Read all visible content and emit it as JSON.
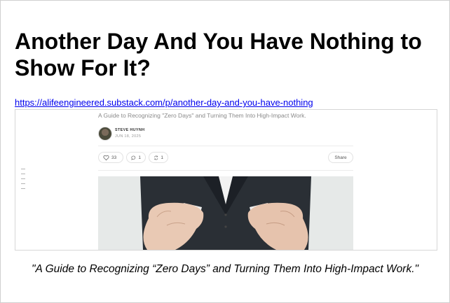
{
  "title": "Another Day And You Have Nothing to Show For It?",
  "link": {
    "text": "https://alifeengineered.substack.com/p/another-day-and-you-have-nothing",
    "href": "https://alifeengineered.substack.com/p/another-day-and-you-have-nothing"
  },
  "preview": {
    "subtitle": "A Guide to Recognizing \"Zero Days\" and Turning Them Into High-Impact Work.",
    "author": "STEVE HUYNH",
    "date": "JUN 18, 2025",
    "likes": "33",
    "comments": "1",
    "restacks": "1",
    "share_label": "Share",
    "icons": {
      "like": "heart-icon",
      "comment": "comment-bubble-icon",
      "restack": "restack-arrows-icon",
      "toc": "table-of-contents-icon"
    }
  },
  "caption": "\"A Guide to Recognizing “Zero Days” and Turning Them Into High-Impact Work.\""
}
